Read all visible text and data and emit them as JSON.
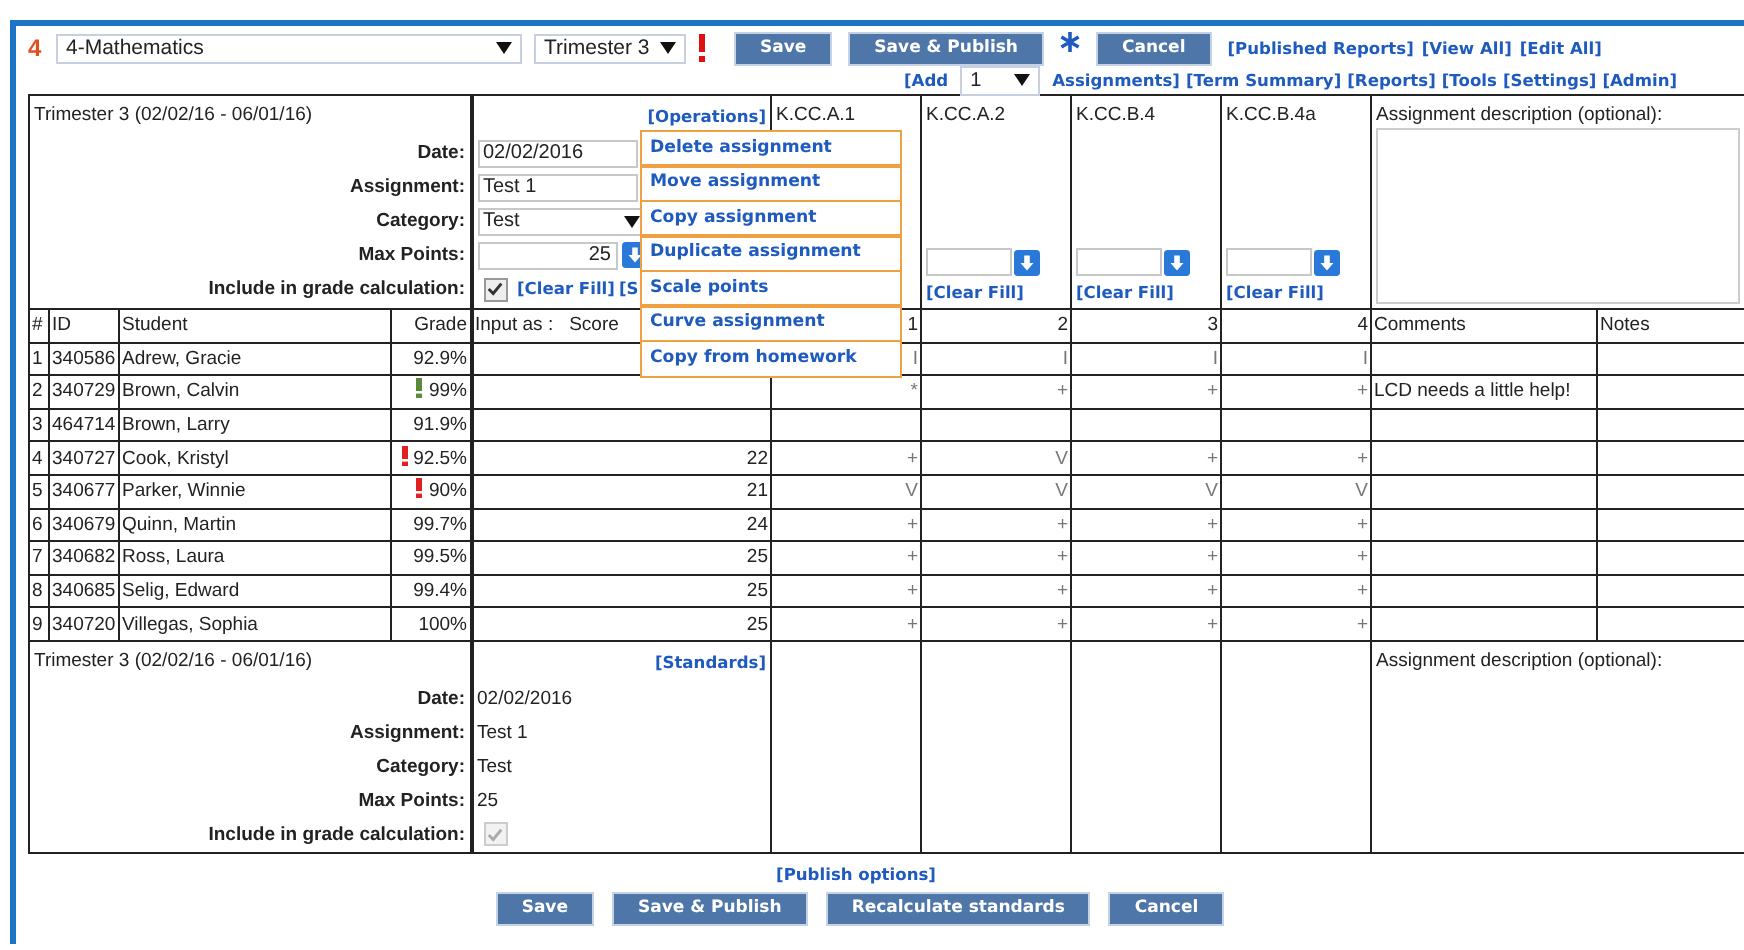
{
  "toolbar": {
    "number": "4",
    "class_select": "4-Mathematics",
    "term_select": "Trimester 3",
    "buttons": [
      "Save",
      "Save & Publish",
      "Cancel"
    ],
    "links": [
      "[Published Reports]",
      "[View All]",
      "[Edit All]"
    ]
  },
  "nav": {
    "add_prefix": "[Add",
    "add_count": "1",
    "add_suffix": "Assignments]",
    "links": [
      "[Term Summary]",
      "[Reports]",
      "[Tools",
      "[Settings]",
      "[Admin]"
    ]
  },
  "edit_panel": {
    "term": "Trimester 3 (02/02/16 - 06/01/16)",
    "operations_link": "[Operations]",
    "fields": [
      {
        "label": "Date:",
        "kind": "text",
        "value": "02/02/2016"
      },
      {
        "label": "Assignment:",
        "kind": "text",
        "value": "Test 1"
      },
      {
        "label": "Category:",
        "kind": "select",
        "value": "Test"
      },
      {
        "label": "Max Points:",
        "kind": "number",
        "value": "25"
      },
      {
        "label": "Include in grade calculation:",
        "kind": "checkbox",
        "checked": true
      }
    ],
    "clear_fill": "[Clear Fill]",
    "cut_link": "[S",
    "standards": [
      {
        "code": "K.CC.A.1"
      },
      {
        "code": "K.CC.A.2",
        "clear_fill": "[Clear Fill]"
      },
      {
        "code": "K.CC.B.4",
        "clear_fill": "[Clear Fill]"
      },
      {
        "code": "K.CC.B.4a",
        "clear_fill": "[Clear Fill]"
      }
    ],
    "description_label": "Assignment description (optional):"
  },
  "operations_menu": {
    "items": [
      "Delete assignment",
      "Move assignment",
      "Copy assignment",
      "Duplicate assignment",
      "Scale points",
      "Curve assignment",
      "Copy from homework"
    ]
  },
  "table": {
    "columns": [
      "#",
      "ID",
      "Student",
      "Grade",
      "1",
      "2",
      "3",
      "4",
      "Comments",
      "Notes"
    ],
    "input_as": "Input as :",
    "input_mode": "Score",
    "rows": [
      {
        "n": "1",
        "id": "340586",
        "student": "Adrew, Gracie",
        "grade": "92.9%",
        "flagged": false,
        "marks": [
          "I",
          "I",
          "I",
          "I"
        ]
      },
      {
        "n": "2",
        "id": "340729",
        "student": "Brown, Calvin",
        "grade": "99%",
        "flagged": true,
        "color": "#5a8a3a",
        "marks": [
          "*",
          "+",
          "+",
          "+"
        ],
        "comment": "LCD needs a little help!"
      },
      {
        "n": "3",
        "id": "464714",
        "student": "Brown, Larry",
        "grade": "91.9%",
        "flagged": false,
        "marks": []
      },
      {
        "n": "4",
        "id": "340727",
        "student": "Cook, Kristyl",
        "grade": "92.5%",
        "flagged": true,
        "color": "#e02020",
        "score": "22",
        "marks": [
          "+",
          "V",
          "+",
          "+"
        ]
      },
      {
        "n": "5",
        "id": "340677",
        "student": "Parker, Winnie",
        "grade": "90%",
        "flagged": true,
        "color": "#e02020",
        "score": "21",
        "marks": [
          "V",
          "V",
          "V",
          "V"
        ]
      },
      {
        "n": "6",
        "id": "340679",
        "student": "Quinn, Martin",
        "grade": "99.7%",
        "flagged": false,
        "score": "24",
        "marks": [
          "+",
          "+",
          "+",
          "+"
        ]
      },
      {
        "n": "7",
        "id": "340682",
        "student": "Ross, Laura",
        "grade": "99.5%",
        "flagged": false,
        "score": "25",
        "marks": [
          "+",
          "+",
          "+",
          "+"
        ]
      },
      {
        "n": "8",
        "id": "340685",
        "student": "Selig, Edward",
        "grade": "99.4%",
        "flagged": false,
        "score": "25",
        "marks": [
          "+",
          "+",
          "+",
          "+"
        ]
      },
      {
        "n": "9",
        "id": "340720",
        "student": "Villegas, Sophia",
        "grade": "100%",
        "flagged": false,
        "score": "25",
        "marks": [
          "+",
          "+",
          "+",
          "+"
        ]
      }
    ]
  },
  "summary_panel": {
    "term": "Trimester 3 (02/02/16 - 06/01/16)",
    "standards_link": "[Standards]",
    "fields": [
      {
        "label": "Date:",
        "kind": "text",
        "value": "02/02/2016"
      },
      {
        "label": "Assignment:",
        "kind": "text",
        "value": "Test 1"
      },
      {
        "label": "Category:",
        "kind": "text",
        "value": "Test"
      },
      {
        "label": "Max Points:",
        "kind": "text",
        "value": "25"
      },
      {
        "label": "Include in grade calculation:",
        "kind": "checkbox",
        "checked": true
      }
    ],
    "description_label": "Assignment description (optional):"
  },
  "footer": {
    "publish_link": "[Publish options]",
    "buttons": [
      "Save",
      "Save & Publish",
      "Recalculate standards",
      "Cancel"
    ]
  }
}
